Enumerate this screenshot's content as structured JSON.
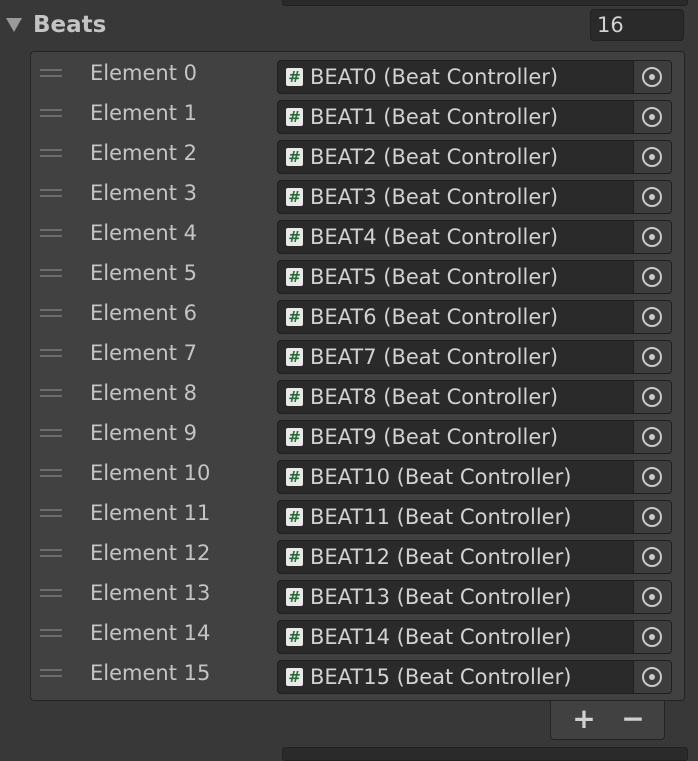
{
  "array": {
    "title": "Beats",
    "size": "16"
  },
  "items": [
    {
      "label": "Element 0",
      "value": "BEAT0 (Beat Controller)"
    },
    {
      "label": "Element 1",
      "value": "BEAT1 (Beat Controller)"
    },
    {
      "label": "Element 2",
      "value": "BEAT2 (Beat Controller)"
    },
    {
      "label": "Element 3",
      "value": "BEAT3 (Beat Controller)"
    },
    {
      "label": "Element 4",
      "value": "BEAT4 (Beat Controller)"
    },
    {
      "label": "Element 5",
      "value": "BEAT5 (Beat Controller)"
    },
    {
      "label": "Element 6",
      "value": "BEAT6 (Beat Controller)"
    },
    {
      "label": "Element 7",
      "value": "BEAT7 (Beat Controller)"
    },
    {
      "label": "Element 8",
      "value": "BEAT8 (Beat Controller)"
    },
    {
      "label": "Element 9",
      "value": "BEAT9 (Beat Controller)"
    },
    {
      "label": "Element 10",
      "value": "BEAT10 (Beat Controller)"
    },
    {
      "label": "Element 11",
      "value": "BEAT11 (Beat Controller)"
    },
    {
      "label": "Element 12",
      "value": "BEAT12 (Beat Controller)"
    },
    {
      "label": "Element 13",
      "value": "BEAT13 (Beat Controller)"
    },
    {
      "label": "Element 14",
      "value": "BEAT14 (Beat Controller)"
    },
    {
      "label": "Element 15",
      "value": "BEAT15 (Beat Controller)"
    }
  ],
  "icons": {
    "script": "#",
    "script_icon_name": "csharp-script-icon",
    "picker_icon_name": "object-picker-icon",
    "drag_icon_name": "drag-handle-icon",
    "foldout_icon_name": "foldout-expanded-icon"
  },
  "footer": {
    "add_label": "+",
    "remove_label": "−"
  },
  "colors": {
    "background": "#383838",
    "list_background": "#414141",
    "field_background": "#2a2a2a",
    "text": "#c4c4c4",
    "script_icon_hash": "#2b6b3a"
  }
}
